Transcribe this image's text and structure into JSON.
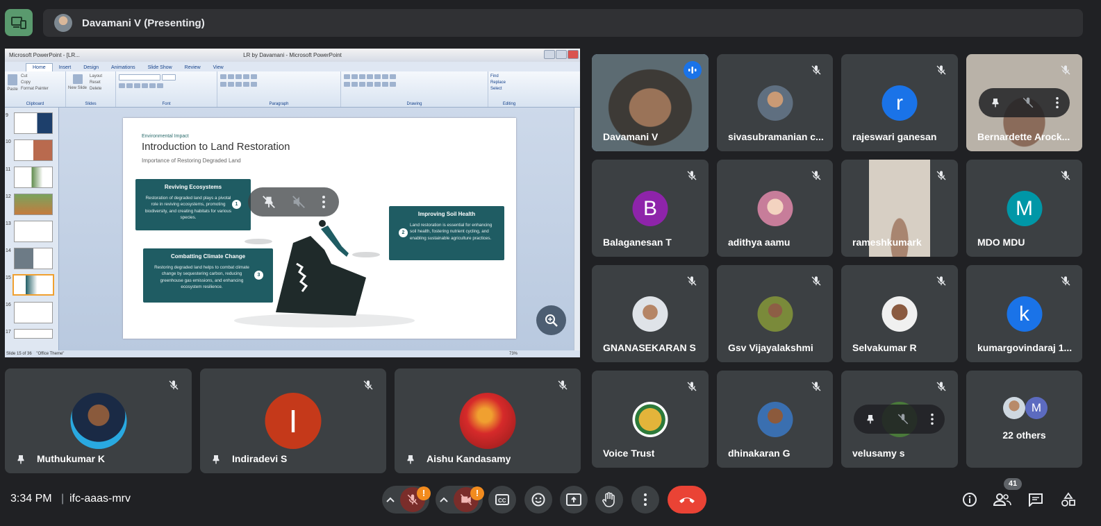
{
  "presenter": {
    "label": "Davamani V (Presenting)"
  },
  "powerpoint": {
    "window_title_left": "Microsoft PowerPoint - [LR...",
    "window_title_center": "LR by Davamani - Microsoft PowerPoint",
    "tabs": [
      "Home",
      "Insert",
      "Design",
      "Animations",
      "Slide Show",
      "Review",
      "View"
    ],
    "groups": [
      "Clipboard",
      "Slides",
      "Font",
      "Paragraph",
      "Drawing",
      "Editing"
    ],
    "clipboard_items": [
      "Cut",
      "Copy",
      "Format Painter"
    ],
    "paste_label": "Paste",
    "slides_items": [
      "Layout",
      "Reset",
      "Delete"
    ],
    "new_slide_label": "New Slide",
    "editing_items": [
      "Find",
      "Replace",
      "Select"
    ],
    "thumb_numbers": [
      "9",
      "10",
      "11",
      "12",
      "13",
      "14",
      "15",
      "16",
      "17"
    ],
    "status_left": "Slide 15 of 36",
    "status_theme": "\"Office Theme\"",
    "zoom": "73%"
  },
  "slide": {
    "tag": "Environmental Impact",
    "title": "Introduction to Land Restoration",
    "subtitle": "Importance of Restoring Degraded Land",
    "cards": [
      {
        "title": "Reviving Ecosystems",
        "body": "Restoration of degraded land plays a pivotal role in reviving ecosystems, promoting biodiversity, and creating habitats for various species.",
        "num": "1"
      },
      {
        "title": "Improving Soil Health",
        "body": "Land restoration is essential for enhancing soil health, fostering nutrient cycling, and enabling sustainable agriculture practices.",
        "num": "2"
      },
      {
        "title": "Combatting Climate Change",
        "body": "Restoring degraded land helps to combat climate change by sequestering carbon, reducing greenhouse gas emissions, and enhancing ecosystem resilience.",
        "num": "3"
      }
    ]
  },
  "participants": {
    "grid": [
      {
        "name": "Davamani V",
        "initial": "",
        "color": ""
      },
      {
        "name": "sivasubramanian c...",
        "initial": "",
        "color": ""
      },
      {
        "name": "rajeswari ganesan",
        "initial": "r",
        "color": "#1a73e8"
      },
      {
        "name": "Bernardette Arock...",
        "initial": "",
        "color": ""
      },
      {
        "name": "Balaganesan T",
        "initial": "B",
        "color": "#8e24aa"
      },
      {
        "name": "adithya aamu",
        "initial": "",
        "color": ""
      },
      {
        "name": "rameshkumark",
        "initial": "",
        "color": ""
      },
      {
        "name": "MDO MDU",
        "initial": "M",
        "color": "#0097a7"
      },
      {
        "name": "GNANASEKARAN S",
        "initial": "",
        "color": ""
      },
      {
        "name": "Gsv Vijayalakshmi",
        "initial": "",
        "color": ""
      },
      {
        "name": "Selvakumar R",
        "initial": "",
        "color": ""
      },
      {
        "name": "kumargovindaraj 1...",
        "initial": "k",
        "color": "#1a73e8"
      },
      {
        "name": "Voice Trust",
        "initial": "",
        "color": ""
      },
      {
        "name": "dhinakaran G",
        "initial": "",
        "color": ""
      },
      {
        "name": "velusamy s",
        "initial": "",
        "color": ""
      }
    ],
    "others_label": "22 others",
    "others_initial": "M",
    "bottom": [
      {
        "name": "Muthukumar K",
        "initial": "",
        "color": ""
      },
      {
        "name": "Indiradevi S",
        "initial": "I",
        "color": "#c5391a"
      },
      {
        "name": "Aishu Kandasamy",
        "initial": "",
        "color": ""
      }
    ]
  },
  "footer": {
    "time": "3:34 PM",
    "separator": "|",
    "meeting_code": "ifc-aaas-mrv",
    "participant_count": "41",
    "warning_glyph": "!"
  },
  "colors": {
    "accent": "#8ab4f8",
    "end_call": "#ea4335",
    "tile_bg": "#3c4043",
    "page_bg": "#202124",
    "warning": "#f28b1e"
  }
}
